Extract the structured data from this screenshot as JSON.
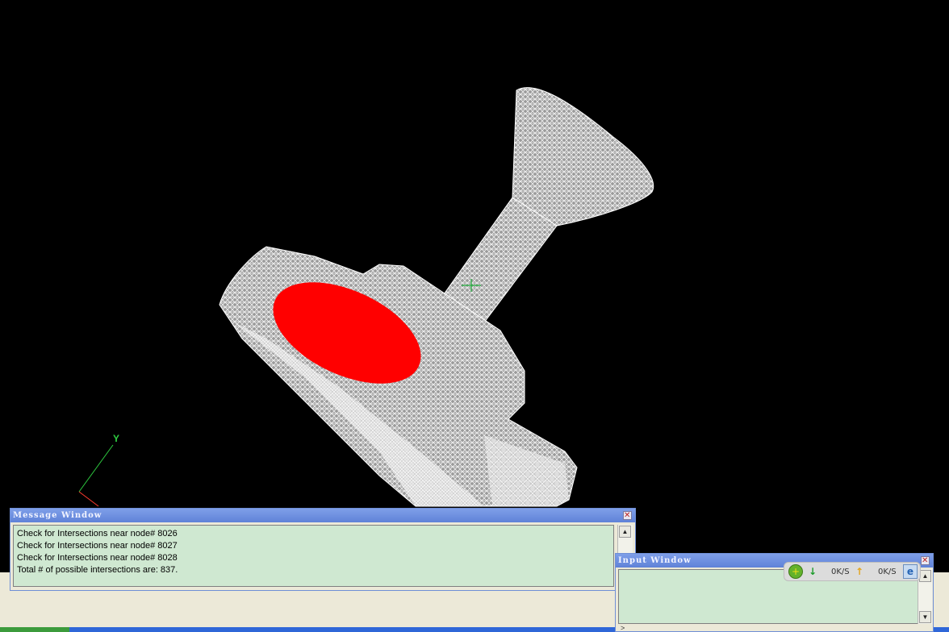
{
  "viewport": {
    "axis": {
      "y_label": "Y"
    },
    "colors": {
      "background": "#000000",
      "mesh": "#e8e8e8",
      "highlight": "#ff0000",
      "axis_y": "#2ecc40",
      "axis_x": "#ff3b30"
    }
  },
  "message_window": {
    "title": "Message Window",
    "lines": [
      "Check for Intersections near node# 8026",
      "Check for Intersections near node# 8027",
      "Check for Intersections near node# 8028",
      "Total # of possible intersections are: 837."
    ]
  },
  "input_window": {
    "title": "Input Window",
    "prompt": ">",
    "value": ""
  },
  "net_meter": {
    "down_icon": "download-arrow-icon",
    "down_rate": "0K/S",
    "up_icon": "upload-arrow-icon",
    "up_rate": "0K/S",
    "browser_icon": "browser-icon"
  },
  "icons": {
    "close": "close-icon",
    "scroll_up": "scroll-up-icon",
    "scroll_down": "scroll-down-icon"
  }
}
